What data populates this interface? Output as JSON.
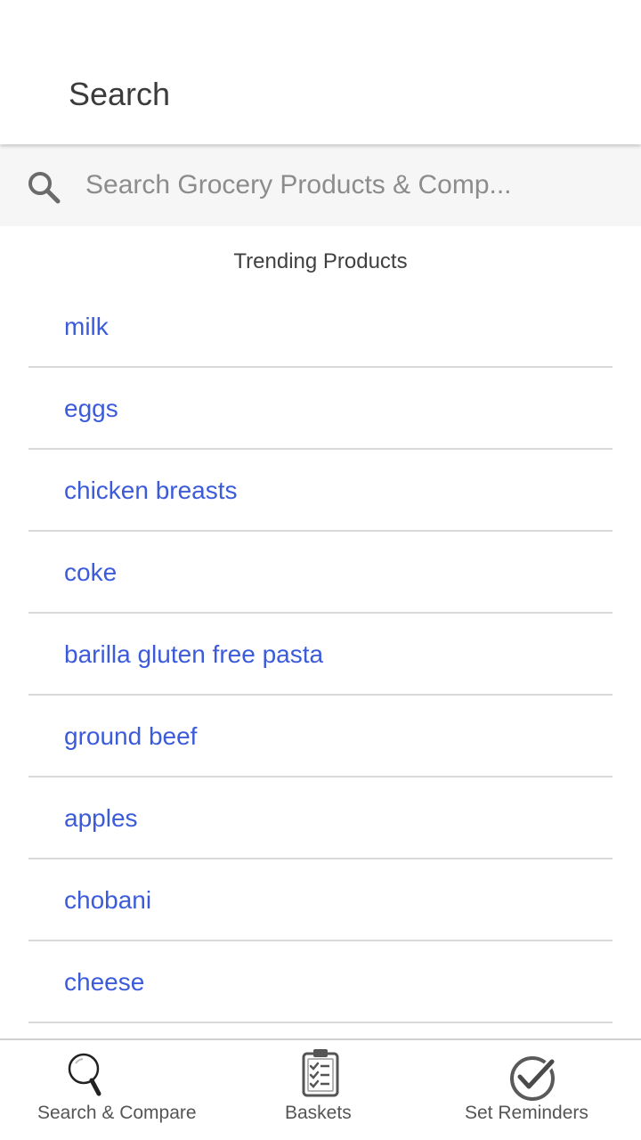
{
  "header": {
    "title": "Search"
  },
  "search": {
    "placeholder": "Search Grocery Products & Comp..."
  },
  "trending": {
    "title": "Trending Products",
    "items": [
      "milk",
      "eggs",
      "chicken breasts",
      "coke",
      "barilla gluten free pasta",
      "ground beef",
      "apples",
      "chobani",
      "cheese"
    ]
  },
  "bottom_nav": {
    "items": [
      {
        "label": "Search & Compare",
        "icon": "magnifier-icon"
      },
      {
        "label": "Baskets",
        "icon": "clipboard-checklist-icon"
      },
      {
        "label": "Set Reminders",
        "icon": "checkmark-circle-icon"
      }
    ]
  },
  "colors": {
    "link": "#3b5bdb",
    "search_bar_bg": "#f6f6f6",
    "divider": "#d9d9d9"
  }
}
